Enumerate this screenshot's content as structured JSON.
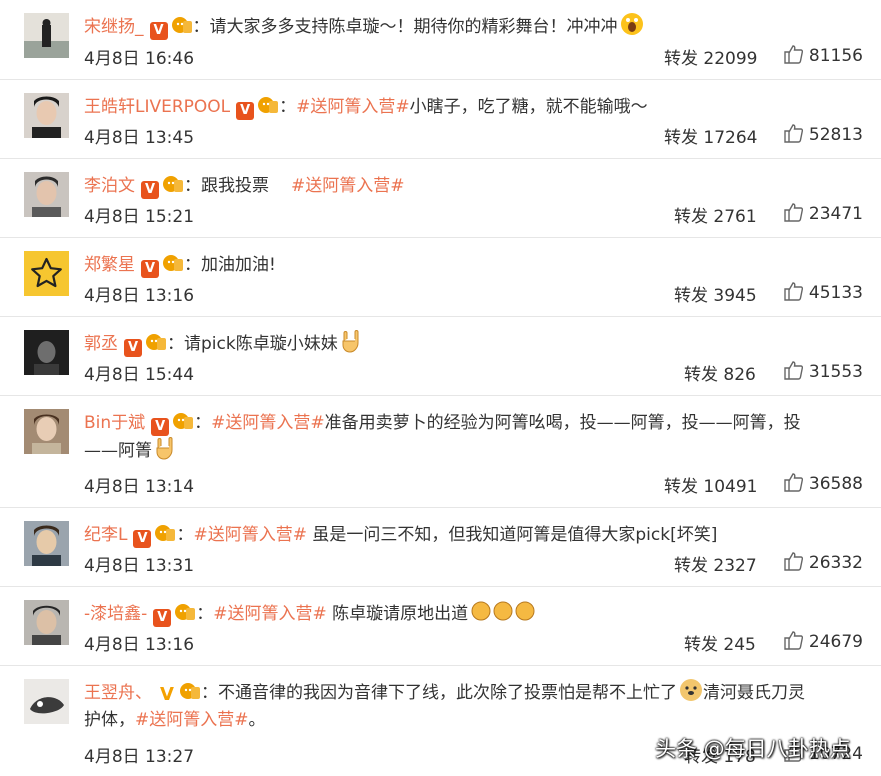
{
  "posts": [
    {
      "name": "宋继扬_",
      "badge": "V",
      "text": "：请大家多多支持陈卓璇～！期待你的精彩舞台！冲冲冲",
      "topic": "",
      "date": "4月8日 16:46",
      "repost": "转发 22099",
      "likes": "81156"
    },
    {
      "name": "王皓轩LIVERPOOL",
      "badge": "V",
      "topic": "#送阿箐入营#",
      "text": "小瞎子，吃了糖，就不能输哦～",
      "date": "4月8日 13:45",
      "repost": "转发 17264",
      "likes": "52813"
    },
    {
      "name": "李泊文",
      "badge": "V",
      "pre": "：跟我投票",
      "topic": "#送阿箐入营#",
      "date": "4月8日 15:21",
      "repost": "转发 2761",
      "likes": "23471"
    },
    {
      "name": "郑繁星",
      "badge": "V",
      "text": "：加油加油!",
      "date": "4月8日 13:16",
      "repost": "转发 3945",
      "likes": "45133"
    },
    {
      "name": "郭丞",
      "badge": "V",
      "text": "：请pick陈卓璇小妹妹",
      "date": "4月8日 15:44",
      "repost": "转发 826",
      "likes": "31553"
    },
    {
      "name": "Bin于斌",
      "badge": "V",
      "topic": "#送阿箐入营#",
      "text": "准备用卖萝卜的经验为阿箐吆喝，投——阿箐，投——阿箐，投",
      "text2": "——阿箐",
      "date": "4月8日 13:14",
      "repost": "转发 10491",
      "likes": "36588"
    },
    {
      "name": "纪李L",
      "badge": "V",
      "topic": "#送阿箐入营#",
      "text": " 虽是一问三不知，但我知道阿箐是值得大家pick[坏笑]",
      "date": "4月8日 13:31",
      "repost": "转发 2327",
      "likes": "26332"
    },
    {
      "name": "-漆培鑫-",
      "badge": "V",
      "topic": "#送阿箐入营#",
      "text": " 陈卓璇请原地出道",
      "date": "4月8日 13:16",
      "repost": "转发 245",
      "likes": "24679"
    },
    {
      "name": "王翌舟、",
      "badge": "V",
      "text": "：不通音律的我因为音律下了线，此次除了投票怕是帮不上忙了",
      "text_b": "清河聂氏刀灵",
      "text2": "护体，",
      "topic2": "#送阿箐入营#",
      "text3": "。",
      "date": "4月8日 13:27",
      "repost": "转发 178",
      "likes": "10724"
    }
  ],
  "colon": "：",
  "watermark": "头条 @每日八卦热点"
}
